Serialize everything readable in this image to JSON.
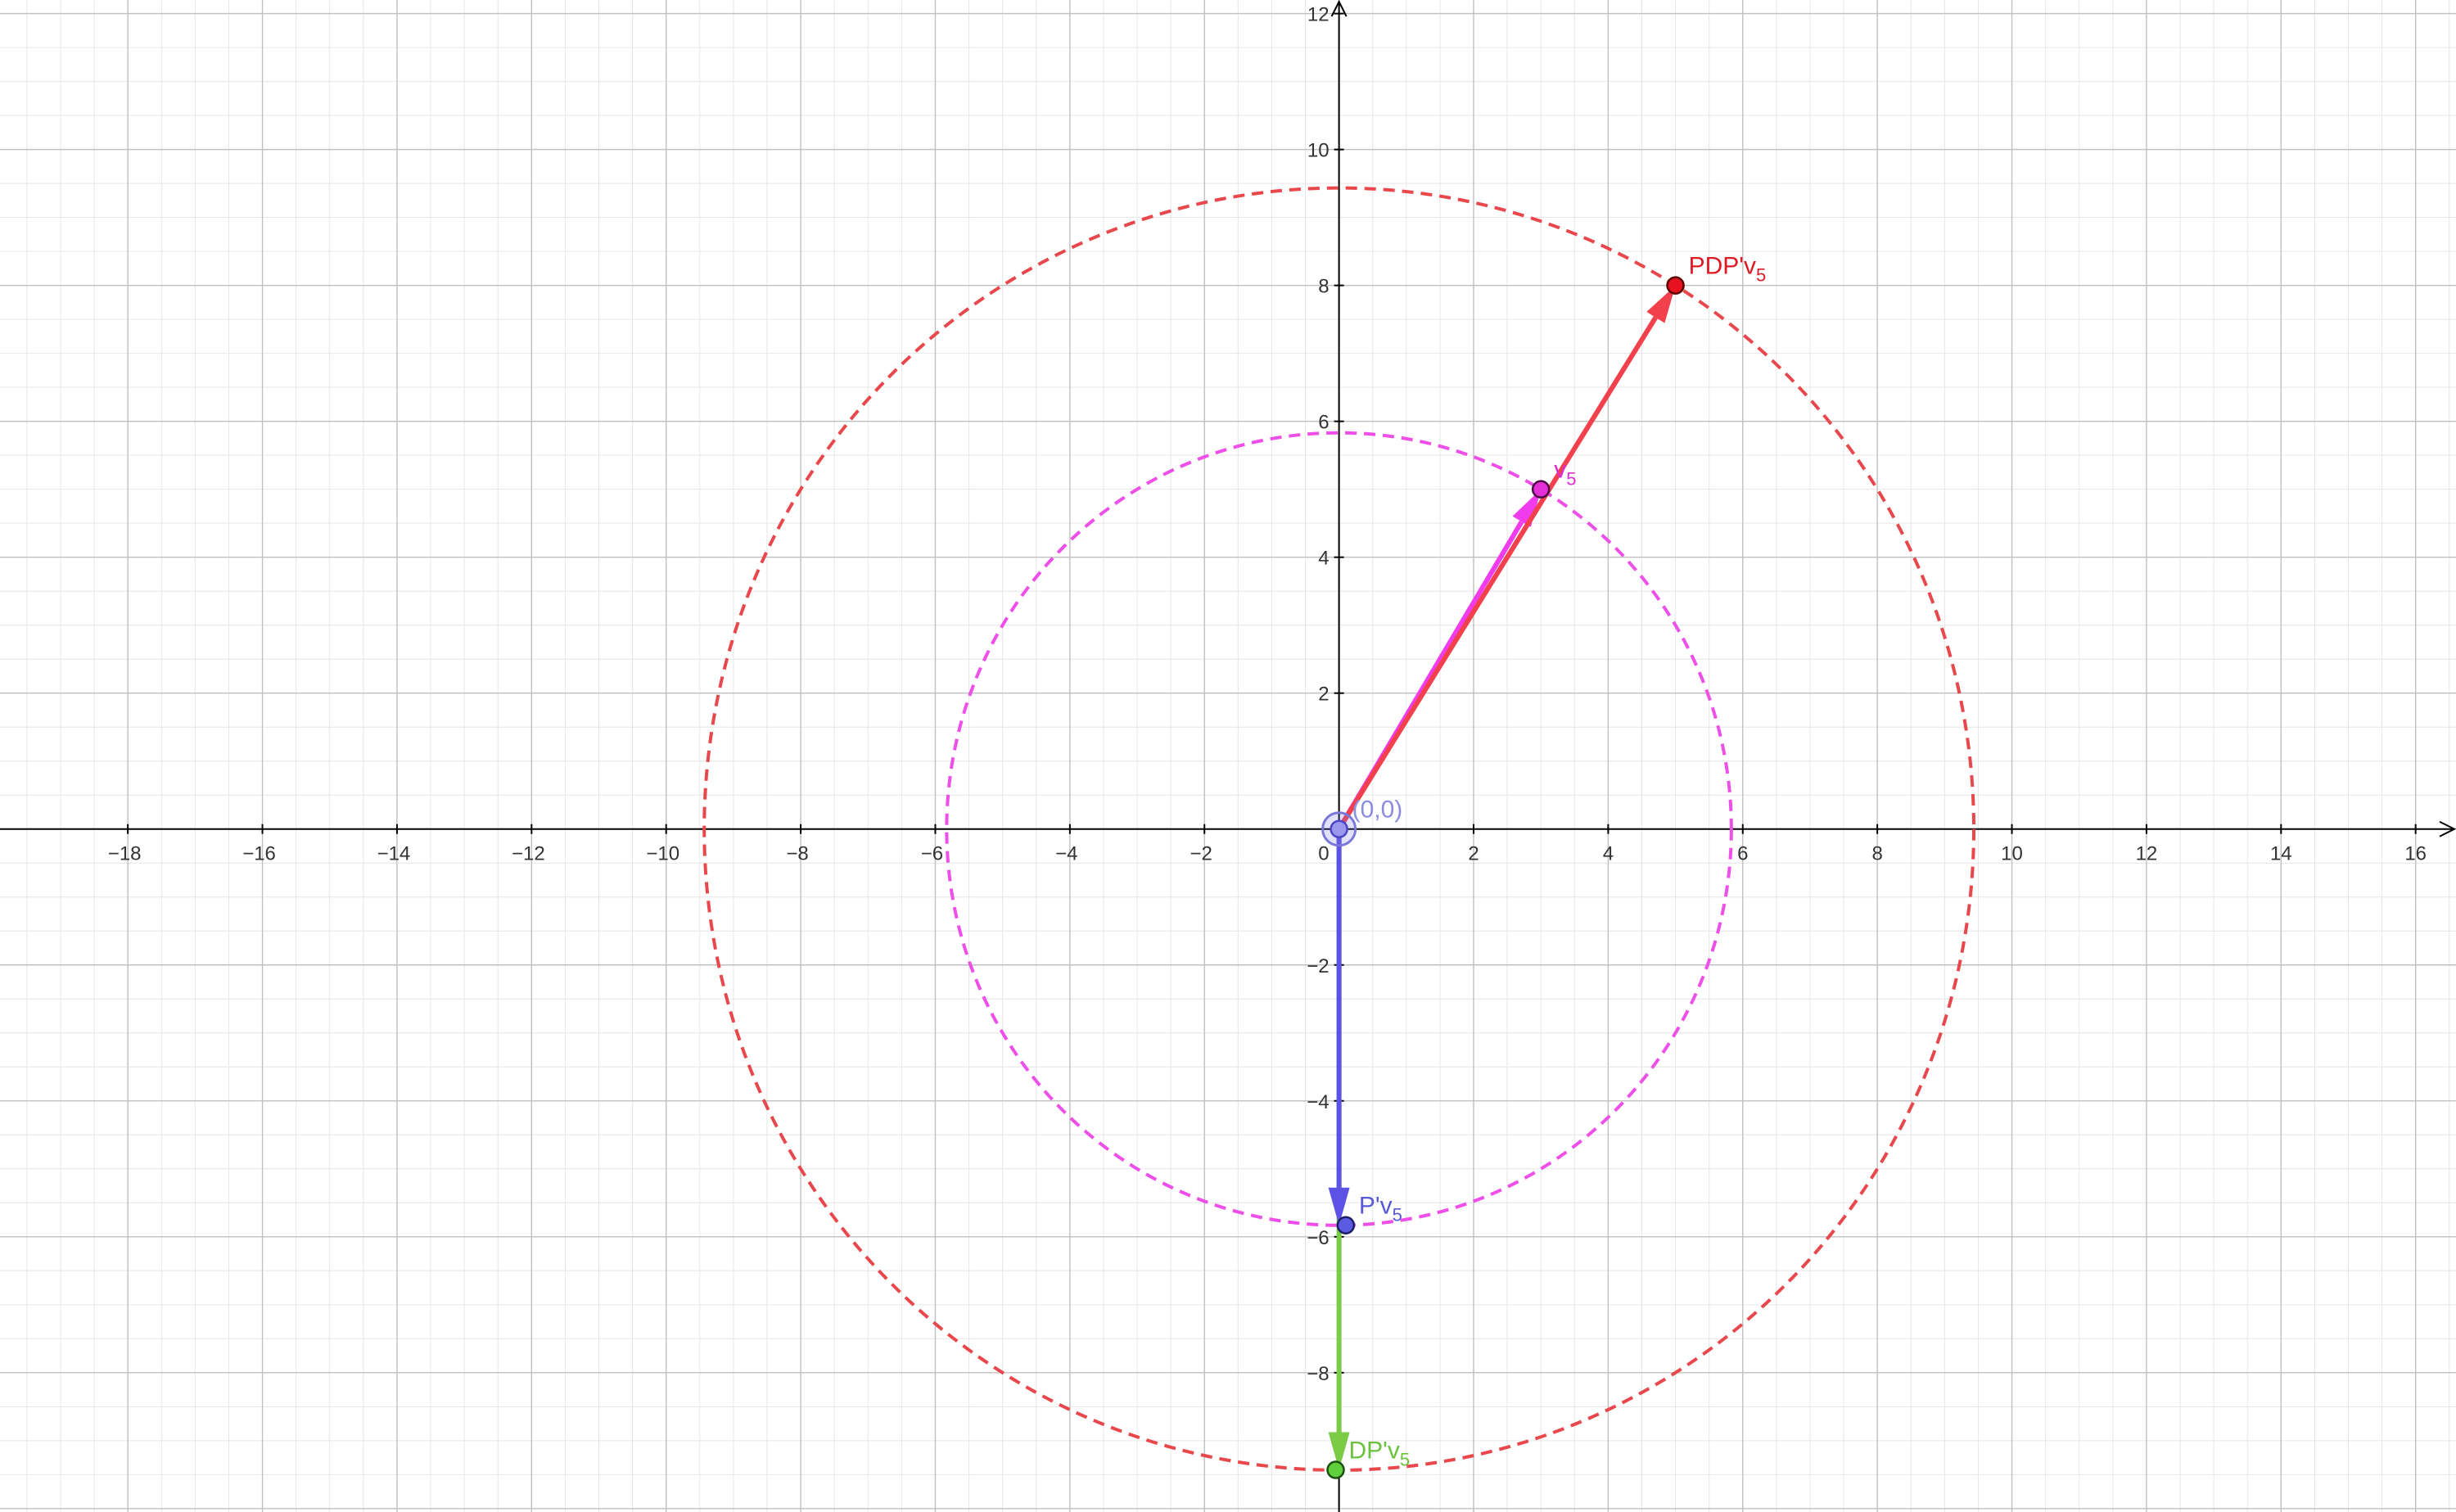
{
  "chart_data": {
    "type": "vector-diagram",
    "xlim": [
      -19.9,
      16.6
    ],
    "ylim": [
      -10.05,
      12.2
    ],
    "grid": true,
    "minor_grid": true,
    "axis_color": "#000000",
    "x_ticks": [
      -18,
      -16,
      -14,
      -12,
      -10,
      -8,
      -6,
      -4,
      -2,
      2,
      4,
      6,
      8,
      10,
      12,
      14,
      16
    ],
    "y_ticks": [
      -8,
      -6,
      -4,
      -2,
      2,
      4,
      6,
      8,
      10,
      12
    ],
    "origin_tick_label": "0",
    "circles": [
      {
        "name": "outer-circle",
        "center": [
          0,
          0
        ],
        "radius": 9.434,
        "color": "#e8474c",
        "style": "dashed"
      },
      {
        "name": "inner-circle",
        "center": [
          0,
          0
        ],
        "radius": 5.831,
        "color": "#ee4fe8",
        "style": "dashed"
      }
    ],
    "vectors": [
      {
        "name": "v5-vector",
        "from": [
          0,
          0
        ],
        "to": [
          3,
          5
        ],
        "color": "#f03ced"
      },
      {
        "name": "pdpv5-vector",
        "from": [
          0,
          0
        ],
        "to": [
          5,
          8
        ],
        "color": "#f2414d"
      },
      {
        "name": "dpv5-vector",
        "from": [
          0,
          0
        ],
        "to": [
          0,
          -9.43
        ],
        "color": "#7acb45"
      },
      {
        "name": "ppv5-vector",
        "from": [
          0,
          0
        ],
        "to": [
          0,
          -5.83
        ],
        "color": "#5d52e6"
      }
    ],
    "points": [
      {
        "name": "origin",
        "x": 0,
        "y": 0,
        "label": "(0,0)",
        "sub": "",
        "color": "#9b98ee",
        "stroke": "#4a46c7",
        "label_color": "#8c8ce0",
        "halo": true
      },
      {
        "name": "v5",
        "x": 3,
        "y": 5,
        "label": "v",
        "sub": "5",
        "color": "#e52fd6",
        "stroke": "#4a0d44",
        "label_color": "#dd2fd0"
      },
      {
        "name": "pdpv5",
        "x": 5,
        "y": 8,
        "label": "PDP'v",
        "sub": "5",
        "color": "#e8121e",
        "stroke": "#5a0000",
        "label_color": "#dd1a25"
      },
      {
        "name": "ppv5",
        "x": 0.1,
        "y": -5.83,
        "label": "P'v",
        "sub": "5",
        "color": "#5a5ae2",
        "stroke": "#1e1e66",
        "label_color": "#5959d6"
      },
      {
        "name": "dpv5",
        "x": -0.05,
        "y": -9.43,
        "label": "DP'v",
        "sub": "5",
        "color": "#5fcf3c",
        "stroke": "#1c5010",
        "label_color": "#6cc23f"
      }
    ]
  }
}
